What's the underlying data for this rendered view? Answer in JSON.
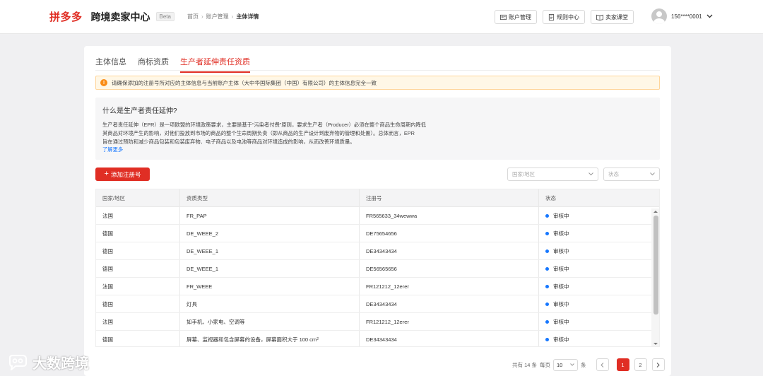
{
  "header": {
    "logo": "拼多多",
    "app_title": "跨境卖家中心",
    "beta": "Beta",
    "breadcrumb": [
      "首页",
      "账户管理",
      "主体详情"
    ],
    "actions": [
      "账户管理",
      "规则中心",
      "卖家课堂"
    ],
    "user": "156****0001"
  },
  "tabs": [
    "主体信息",
    "商标资质",
    "生产者延伸责任资质"
  ],
  "active_tab": 2,
  "alert": "请确保添加的注册号所对应的主体信息与当前账户主体（大中华国际集团（中国）有限公司）的主体信息完全一致",
  "info": {
    "title": "什么是生产者责任延伸?",
    "lines": [
      "生产者责任延伸（EPR）是一项欧盟的环境政策要求，主要是基于“污染者付费”原则，要求生产者（Producer）必须在整个商品生命周期内降低",
      "其商品对环境产生的影响，对他们投放到市场的商品的整个生命周期负责（即从商品的生产设计到废弃物的管理和处置）。总体而言，EPR",
      "旨在通过预防和减少商品包装和包装废弃物、电子商品以及电池等商品对环境造成的影响，从而改善环境质量。"
    ],
    "more": "了解更多"
  },
  "toolbar": {
    "add_label": "添加注册号",
    "region_placeholder": "国家/地区",
    "status_placeholder": "状态"
  },
  "table": {
    "columns": [
      "国家/地区",
      "资质类型",
      "注册号",
      "状态"
    ],
    "rows": [
      [
        "法国",
        "FR_PAP",
        "FR565633_34wewwa",
        "审核中"
      ],
      [
        "德国",
        "DE_WEEE_2",
        "DE75654656",
        "审核中"
      ],
      [
        "德国",
        "DE_WEEE_1",
        "DE34343434",
        "审核中"
      ],
      [
        "德国",
        "DE_WEEE_1",
        "DE56565656",
        "审核中"
      ],
      [
        "法国",
        "FR_WEEE",
        "FR121212_12erer",
        "审核中"
      ],
      [
        "德国",
        "灯具",
        "DE34343434",
        "审核中"
      ],
      [
        "法国",
        "如手机、小家电、空调等",
        "FR121212_12erer",
        "审核中"
      ],
      [
        "德国",
        "屏幕、监视器和包含屏幕的设备，屏幕面积大于 100 cm",
        "DE34343434",
        "审核中"
      ]
    ],
    "last_row_superscript": "2"
  },
  "pagination": {
    "total": "共有 14 条",
    "per_page_label": "每页",
    "per_page": "10",
    "unit": "条",
    "pages": [
      "1",
      "2"
    ],
    "current": "1"
  },
  "watermark": "大数跨境",
  "colors": {
    "brand": "#e02e24",
    "status_dot": "#1677ff",
    "alert_bg": "#fff7e6"
  }
}
